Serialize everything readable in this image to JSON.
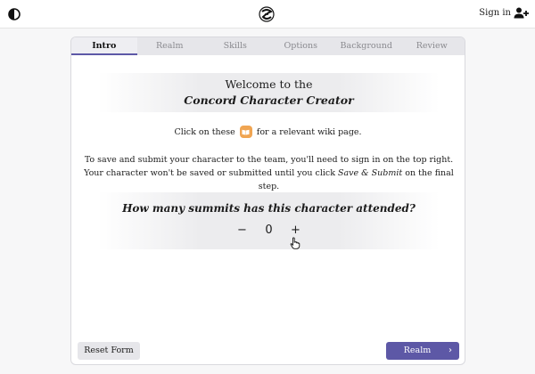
{
  "header": {
    "signin_label": "Sign in",
    "icons": [
      "contrast-icon",
      "concord-logo",
      "add-user-icon"
    ]
  },
  "tabs": [
    {
      "label": "Intro",
      "active": true
    },
    {
      "label": "Realm",
      "active": false
    },
    {
      "label": "Skills",
      "active": false
    },
    {
      "label": "Options",
      "active": false
    },
    {
      "label": "Background",
      "active": false
    },
    {
      "label": "Review",
      "active": false
    }
  ],
  "welcome": {
    "line1": "Welcome to the",
    "line2": "Concord Character Creator"
  },
  "wiki_hint": {
    "before": "Click on these",
    "after": "for a relevant wiki page.",
    "icon": "book-icon"
  },
  "info": {
    "text_before": "To save and submit your character to the team, you'll need to sign in on the top right. Your character won't be saved or submitted until you click ",
    "emphasis": "Save & Submit",
    "text_after": " on the final step."
  },
  "summits": {
    "question": "How many summits has this character attended?",
    "minus": "−",
    "value": "0",
    "plus": "+"
  },
  "footer": {
    "reset_label": "Reset Form",
    "next_label": "Realm",
    "next_chevron": "›"
  },
  "colors": {
    "accent": "#5d58a6",
    "wiki_badge": "#f0a552",
    "tabs_bg": "#e6e6ea"
  }
}
